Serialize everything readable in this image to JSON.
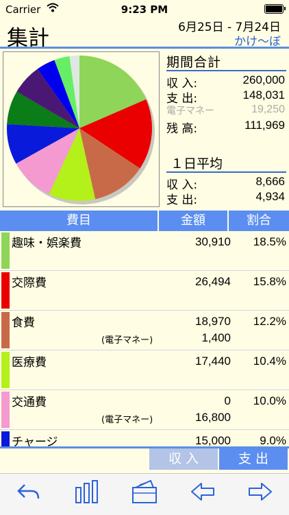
{
  "status": {
    "carrier": "Carrier",
    "time": "9:23 PM"
  },
  "header": {
    "title": "集計",
    "range": "6月25日 - 7月24日",
    "link": "かけ～ぼ"
  },
  "period": {
    "heading": "期間合計",
    "rows": [
      {
        "label": "収 入:",
        "value": "260,000"
      },
      {
        "label": "支 出:",
        "value": "148,031"
      },
      {
        "label": "電子マネー",
        "value": "19,250"
      },
      {
        "label": "残 高:",
        "value": "111,969"
      }
    ]
  },
  "daily": {
    "heading": "１日平均",
    "rows": [
      {
        "label": "収 入:",
        "value": "8,666"
      },
      {
        "label": "支 出:",
        "value": "4,934"
      }
    ]
  },
  "table": {
    "headers": [
      "費目",
      "金額",
      "割合"
    ],
    "rows": [
      {
        "name": "趣味・娯楽費",
        "amount": "30,910",
        "pct": "18.5%",
        "color": "#8ed55a"
      },
      {
        "name": "交際費",
        "amount": "26,494",
        "pct": "15.8%",
        "color": "#ea0000"
      },
      {
        "name": "食費",
        "amount": "18,970",
        "pct": "12.2%",
        "color": "#c86a48",
        "sub_label": "(電子マネー)",
        "sub_amount": "1,400"
      },
      {
        "name": "医療費",
        "amount": "17,440",
        "pct": "10.4%",
        "color": "#b4f01a"
      },
      {
        "name": "交通費",
        "amount": "0",
        "pct": "10.0%",
        "color": "#f49ad0",
        "sub_label": "(電子マネー)",
        "sub_amount": "16,800"
      },
      {
        "name": "チャージ",
        "amount": "15,000",
        "pct": "9.0%",
        "color": "#0a1adb"
      }
    ]
  },
  "chart_data": {
    "type": "pie",
    "values": [
      18.5,
      15.8,
      12.2,
      10.4,
      10.0,
      9.0,
      7.5,
      6.8,
      4.2,
      3.4,
      2.2
    ],
    "colors": [
      "#8ed55a",
      "#ea0000",
      "#c86a48",
      "#b4f01a",
      "#f49ad0",
      "#0a1adb",
      "#0a7c18",
      "#4a1874",
      "#0000ee",
      "#66ee66",
      "#dde9e0"
    ]
  },
  "segment": {
    "income": "収 入",
    "expense": "支 出"
  },
  "toolbar": {
    "icons": [
      "back-arrow-icon",
      "bar-chart-icon",
      "wallet-icon",
      "prev-arrow-icon",
      "next-arrow-icon"
    ]
  }
}
